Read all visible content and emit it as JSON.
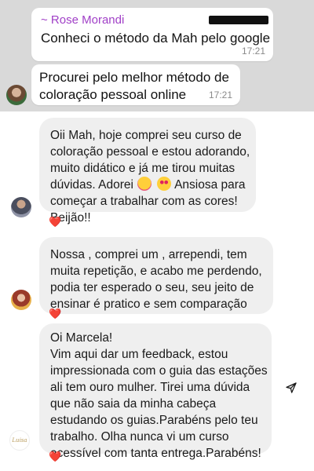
{
  "chat": {
    "messages": [
      {
        "sender": "~ Rose Morandi",
        "text": "Conheci o método da Mah pelo google",
        "time": "17:21"
      },
      {
        "text_lines": [
          "Procurei pelo melhor método de",
          "coloração pessoal online"
        ],
        "time": "17:21"
      }
    ]
  },
  "testimonials": [
    {
      "lines": [
        "Oii Mah, hoje comprei seu curso de",
        "coloração pessoal e estou adorando,",
        "muito didático e já me tirou muitas",
        "dúvidas. Adorei",
        "Ansiosa para",
        "começar a trabalhar com as cores!",
        "Beijão!!"
      ],
      "reaction": "❤️"
    },
    {
      "lines": [
        "Nossa , comprei um , arrependi, tem",
        "muita repetição,  e acabo me perdendo,",
        "podia ter esperado o seu, seu jeito de",
        "ensinar é pratico e sem comparação"
      ],
      "reaction": "❤️"
    },
    {
      "lines": [
        "Oi Marcela!",
        "Vim aqui dar um feedback, estou",
        "impressionada com o guia das estações",
        "ali tem ouro mulher. Tirei uma dúvida",
        "que não saia da minha cabeça",
        "estudando os guias.Parabéns pelo teu",
        "trabalho. Olha nunca vi um curso",
        "acessível com tanta entrega.Parabéns!"
      ],
      "reaction": "❤️",
      "avatar_text": "Luisa"
    }
  ],
  "icons": {
    "send": "send-icon",
    "heart": "heart-icon"
  },
  "colors": {
    "sender_name": "#a03fc7",
    "bubble_gray": "#efefef",
    "heart": "#e0245e"
  }
}
